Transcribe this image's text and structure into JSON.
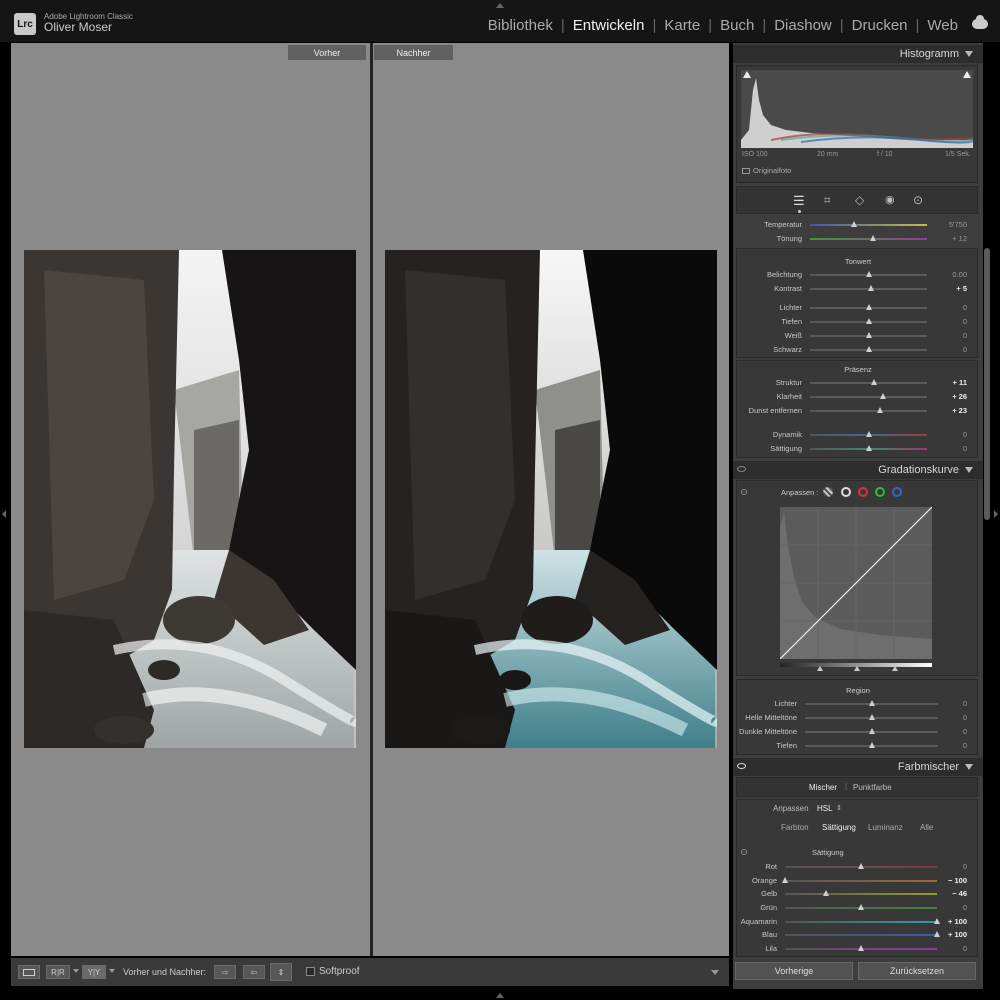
{
  "app": {
    "name": "Adobe Lightroom Classic",
    "logo": "Lrc",
    "user": "Oliver Moser"
  },
  "modules": [
    {
      "label": "Bibliothek",
      "active": false
    },
    {
      "label": "Entwickeln",
      "active": true
    },
    {
      "label": "Karte",
      "active": false
    },
    {
      "label": "Buch",
      "active": false
    },
    {
      "label": "Diashow",
      "active": false
    },
    {
      "label": "Drucken",
      "active": false
    },
    {
      "label": "Web",
      "active": false
    }
  ],
  "compare": {
    "before": "Vorher",
    "after": "Nachher"
  },
  "toolbar": {
    "view_yy": "Y|Y",
    "view_rr": "R|R",
    "compare_label": "Vorher und Nachher:",
    "softproof": "Softproof",
    "softproof_checked": false
  },
  "histogram": {
    "title": "Histogramm",
    "iso": "ISO 100",
    "focal": "20 mm",
    "aperture": "f / 10",
    "shutter": "1/5 Sek.",
    "original": "Originalfoto"
  },
  "tools": [
    "sliders-icon",
    "crop-icon",
    "eraser-icon",
    "eye-icon",
    "mask-icon"
  ],
  "basic": {
    "wb_rows": [
      {
        "label": "Temperatur",
        "value": "5'750",
        "pos": 0.38,
        "bold": false
      },
      {
        "label": "Tönung",
        "value": "+ 12",
        "pos": 0.54,
        "bold": false
      }
    ],
    "tone_title": "Tonwert",
    "tone_rows": [
      {
        "label": "Belichtung",
        "value": "0.00",
        "pos": 0.5,
        "bold": false
      },
      {
        "label": "Kontrast",
        "value": "+ 5",
        "pos": 0.52,
        "bold": true
      },
      {
        "label": "Lichter",
        "value": "0",
        "pos": 0.5,
        "bold": false
      },
      {
        "label": "Tiefen",
        "value": "0",
        "pos": 0.5,
        "bold": false
      },
      {
        "label": "Weiß",
        "value": "0",
        "pos": 0.5,
        "bold": false
      },
      {
        "label": "Schwarz",
        "value": "0",
        "pos": 0.5,
        "bold": false
      }
    ],
    "presence_title": "Präsenz",
    "presence_rows": [
      {
        "label": "Struktur",
        "value": "+ 11",
        "pos": 0.55,
        "bold": true
      },
      {
        "label": "Klarheit",
        "value": "+ 26",
        "pos": 0.62,
        "bold": true
      },
      {
        "label": "Dunst entfernen",
        "value": "+ 23",
        "pos": 0.6,
        "bold": true
      },
      {
        "label": "Dynamik",
        "value": "0",
        "pos": 0.5,
        "bold": false
      },
      {
        "label": "Sättigung",
        "value": "0",
        "pos": 0.5,
        "bold": false
      }
    ]
  },
  "curve": {
    "title": "Gradationskurve",
    "adjust": "Anpassen :",
    "region_title": "Region",
    "region_rows": [
      {
        "label": "Lichter",
        "value": "0",
        "pos": 0.5,
        "bold": false
      },
      {
        "label": "Helle Mitteltöne",
        "value": "0",
        "pos": 0.5,
        "bold": false
      },
      {
        "label": "Dunkle Mitteltöne",
        "value": "0",
        "pos": 0.5,
        "bold": false
      },
      {
        "label": "Tiefen",
        "value": "0",
        "pos": 0.5,
        "bold": false
      }
    ]
  },
  "mixer": {
    "title": "Farbmischer",
    "tab1": "Mischer",
    "tab2": "Punktfarbe",
    "adjust": "Anpassen",
    "mode": "HSL",
    "sub": [
      "Farbton",
      "Sättigung",
      "Luminanz",
      "Alle"
    ],
    "active_sub": "Sättigung",
    "sat_title": "Sättigung",
    "rows": [
      {
        "label": "Rot",
        "value": "0",
        "pos": 0.5,
        "bold": false,
        "grad": "#8a3a3a"
      },
      {
        "label": "Orange",
        "value": "− 100",
        "pos": 0.0,
        "bold": true,
        "grad": "#a06a30"
      },
      {
        "label": "Gelb",
        "value": "− 46",
        "pos": 0.27,
        "bold": true,
        "grad": "#9a9a30"
      },
      {
        "label": "Grün",
        "value": "0",
        "pos": 0.5,
        "bold": false,
        "grad": "#3a8a3a"
      },
      {
        "label": "Aquamarin",
        "value": "+ 100",
        "pos": 1.0,
        "bold": true,
        "grad": "#30a0a0"
      },
      {
        "label": "Blau",
        "value": "+ 100",
        "pos": 1.0,
        "bold": true,
        "grad": "#3a5aa8"
      },
      {
        "label": "Lila",
        "value": "0",
        "pos": 0.5,
        "bold": false,
        "grad": "#8a3a9a"
      }
    ]
  },
  "buttons": {
    "previous": "Vorherige",
    "reset": "Zurücksetzen"
  }
}
